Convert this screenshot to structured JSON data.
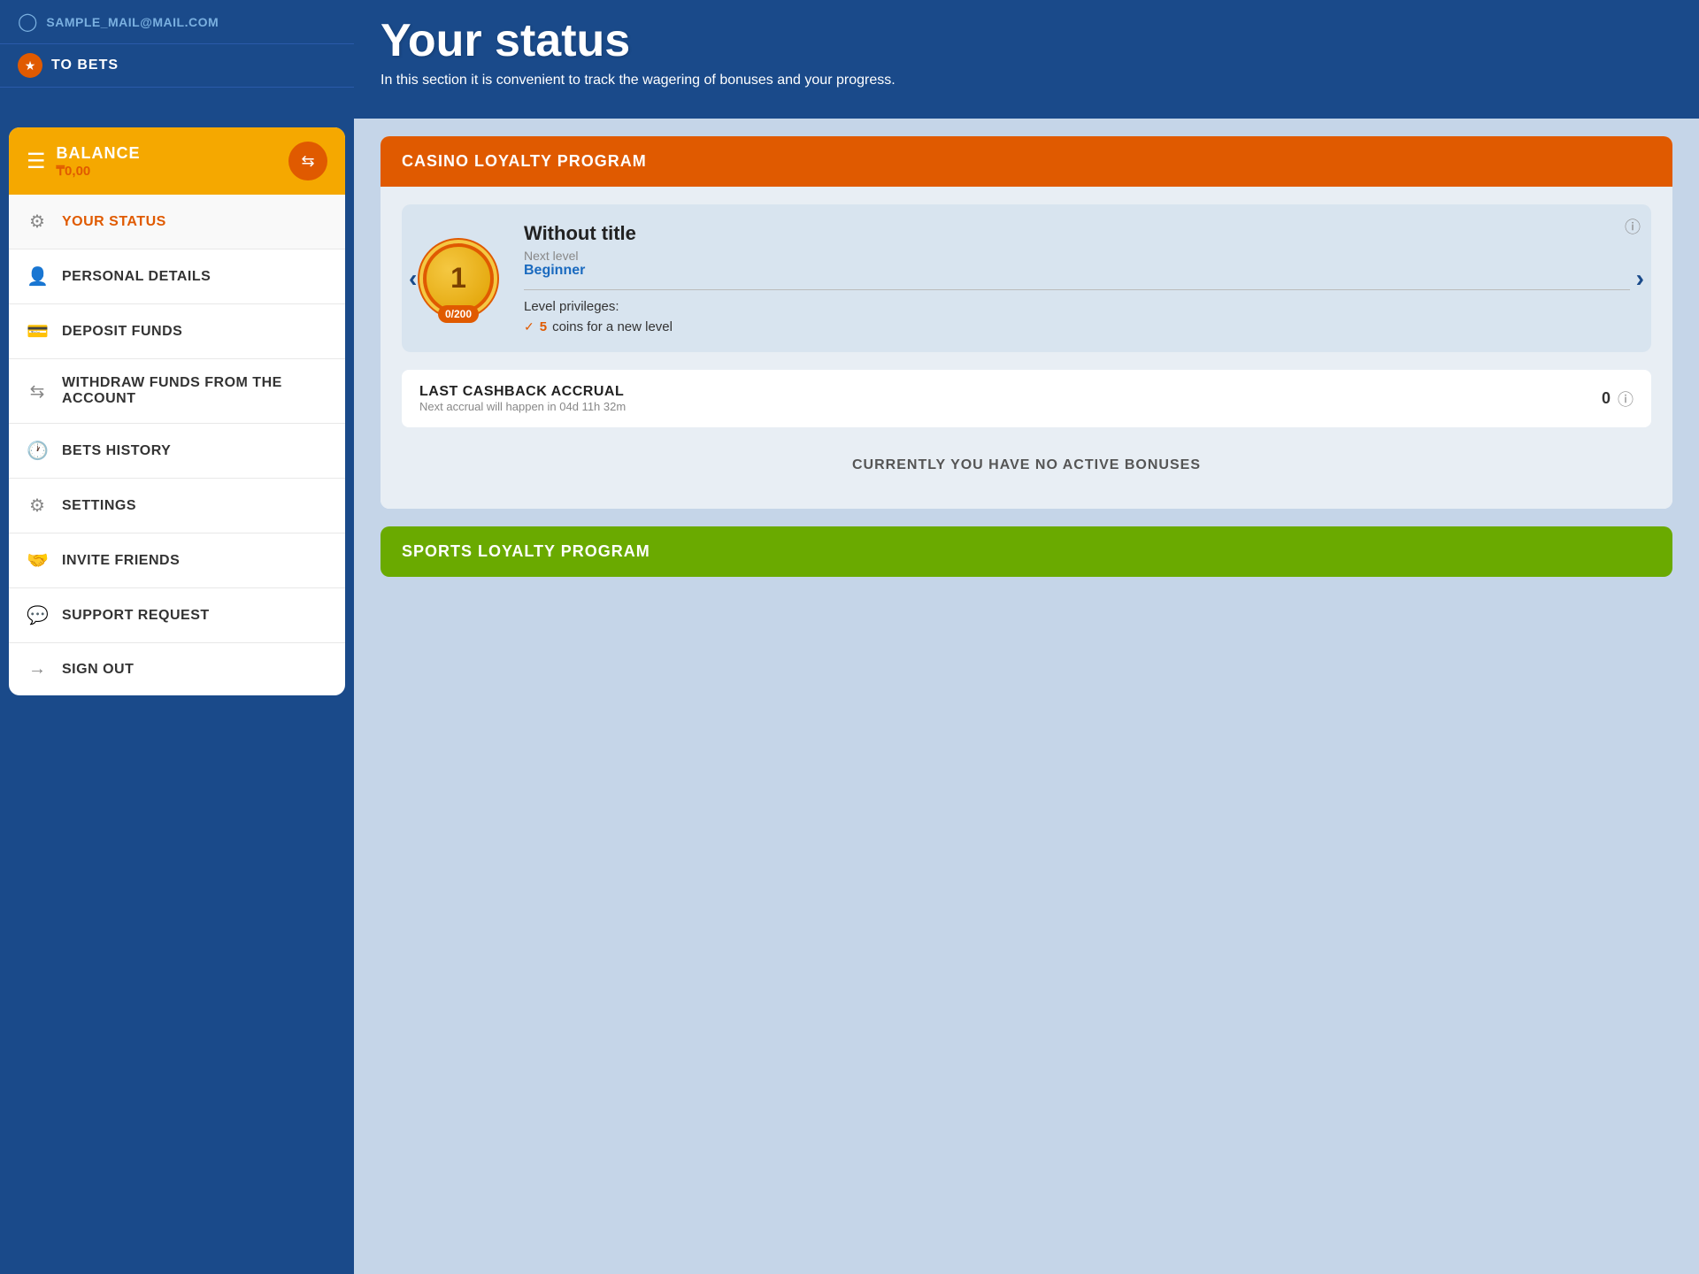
{
  "header": {
    "email": "SAMPLE_MAIL@MAIL.COM",
    "to_bets_label": "TO BETS"
  },
  "sidebar": {
    "balance_label": "BALANCE",
    "balance_amount": "₸0,00",
    "menu_items": [
      {
        "id": "your-status",
        "label": "YOUR STATUS",
        "icon": "⚙",
        "active": true
      },
      {
        "id": "personal-details",
        "label": "PERSONAL DETAILS",
        "icon": "👤",
        "active": false
      },
      {
        "id": "deposit-funds",
        "label": "DEPOSIT FUNDS",
        "icon": "💳",
        "active": false
      },
      {
        "id": "withdraw-funds",
        "label": "WITHDRAW FUNDS FROM THE ACCOUNT",
        "icon": "🔄",
        "active": false
      },
      {
        "id": "bets-history",
        "label": "BETS HISTORY",
        "icon": "🕐",
        "active": false
      },
      {
        "id": "settings",
        "label": "SETTINGS",
        "icon": "⚙",
        "active": false
      },
      {
        "id": "invite-friends",
        "label": "INVITE FRIENDS",
        "icon": "🤝",
        "active": false
      },
      {
        "id": "support-request",
        "label": "SUPPORT REQUEST",
        "icon": "💬",
        "active": false
      },
      {
        "id": "sign-out",
        "label": "SIGN OUT",
        "icon": "⬅",
        "active": false
      }
    ]
  },
  "content": {
    "page_title": "Your status",
    "page_subtitle": "In this section it is convenient to track the wagering of bonuses and your progress.",
    "casino_loyalty": {
      "header_title": "CASINO LOYALTY PROGRAM",
      "level_card": {
        "level_number": "1",
        "level_progress": "0/200",
        "title": "Without title",
        "next_level_label": "Next level",
        "next_level_value": "Beginner",
        "privileges_label": "Level privileges:",
        "privilege_coins": "5",
        "privilege_text": "coins for a new level"
      },
      "cashback": {
        "title": "LAST CASHBACK ACCRUAL",
        "subtitle": "Next accrual will happen in 04d 11h 32m",
        "value": "0"
      },
      "no_bonuses_text": "CURRENTLY YOU HAVE NO ACTIVE BONUSES"
    },
    "sports_loyalty": {
      "header_title": "SPORTS LOYALTY PROGRAM"
    }
  }
}
